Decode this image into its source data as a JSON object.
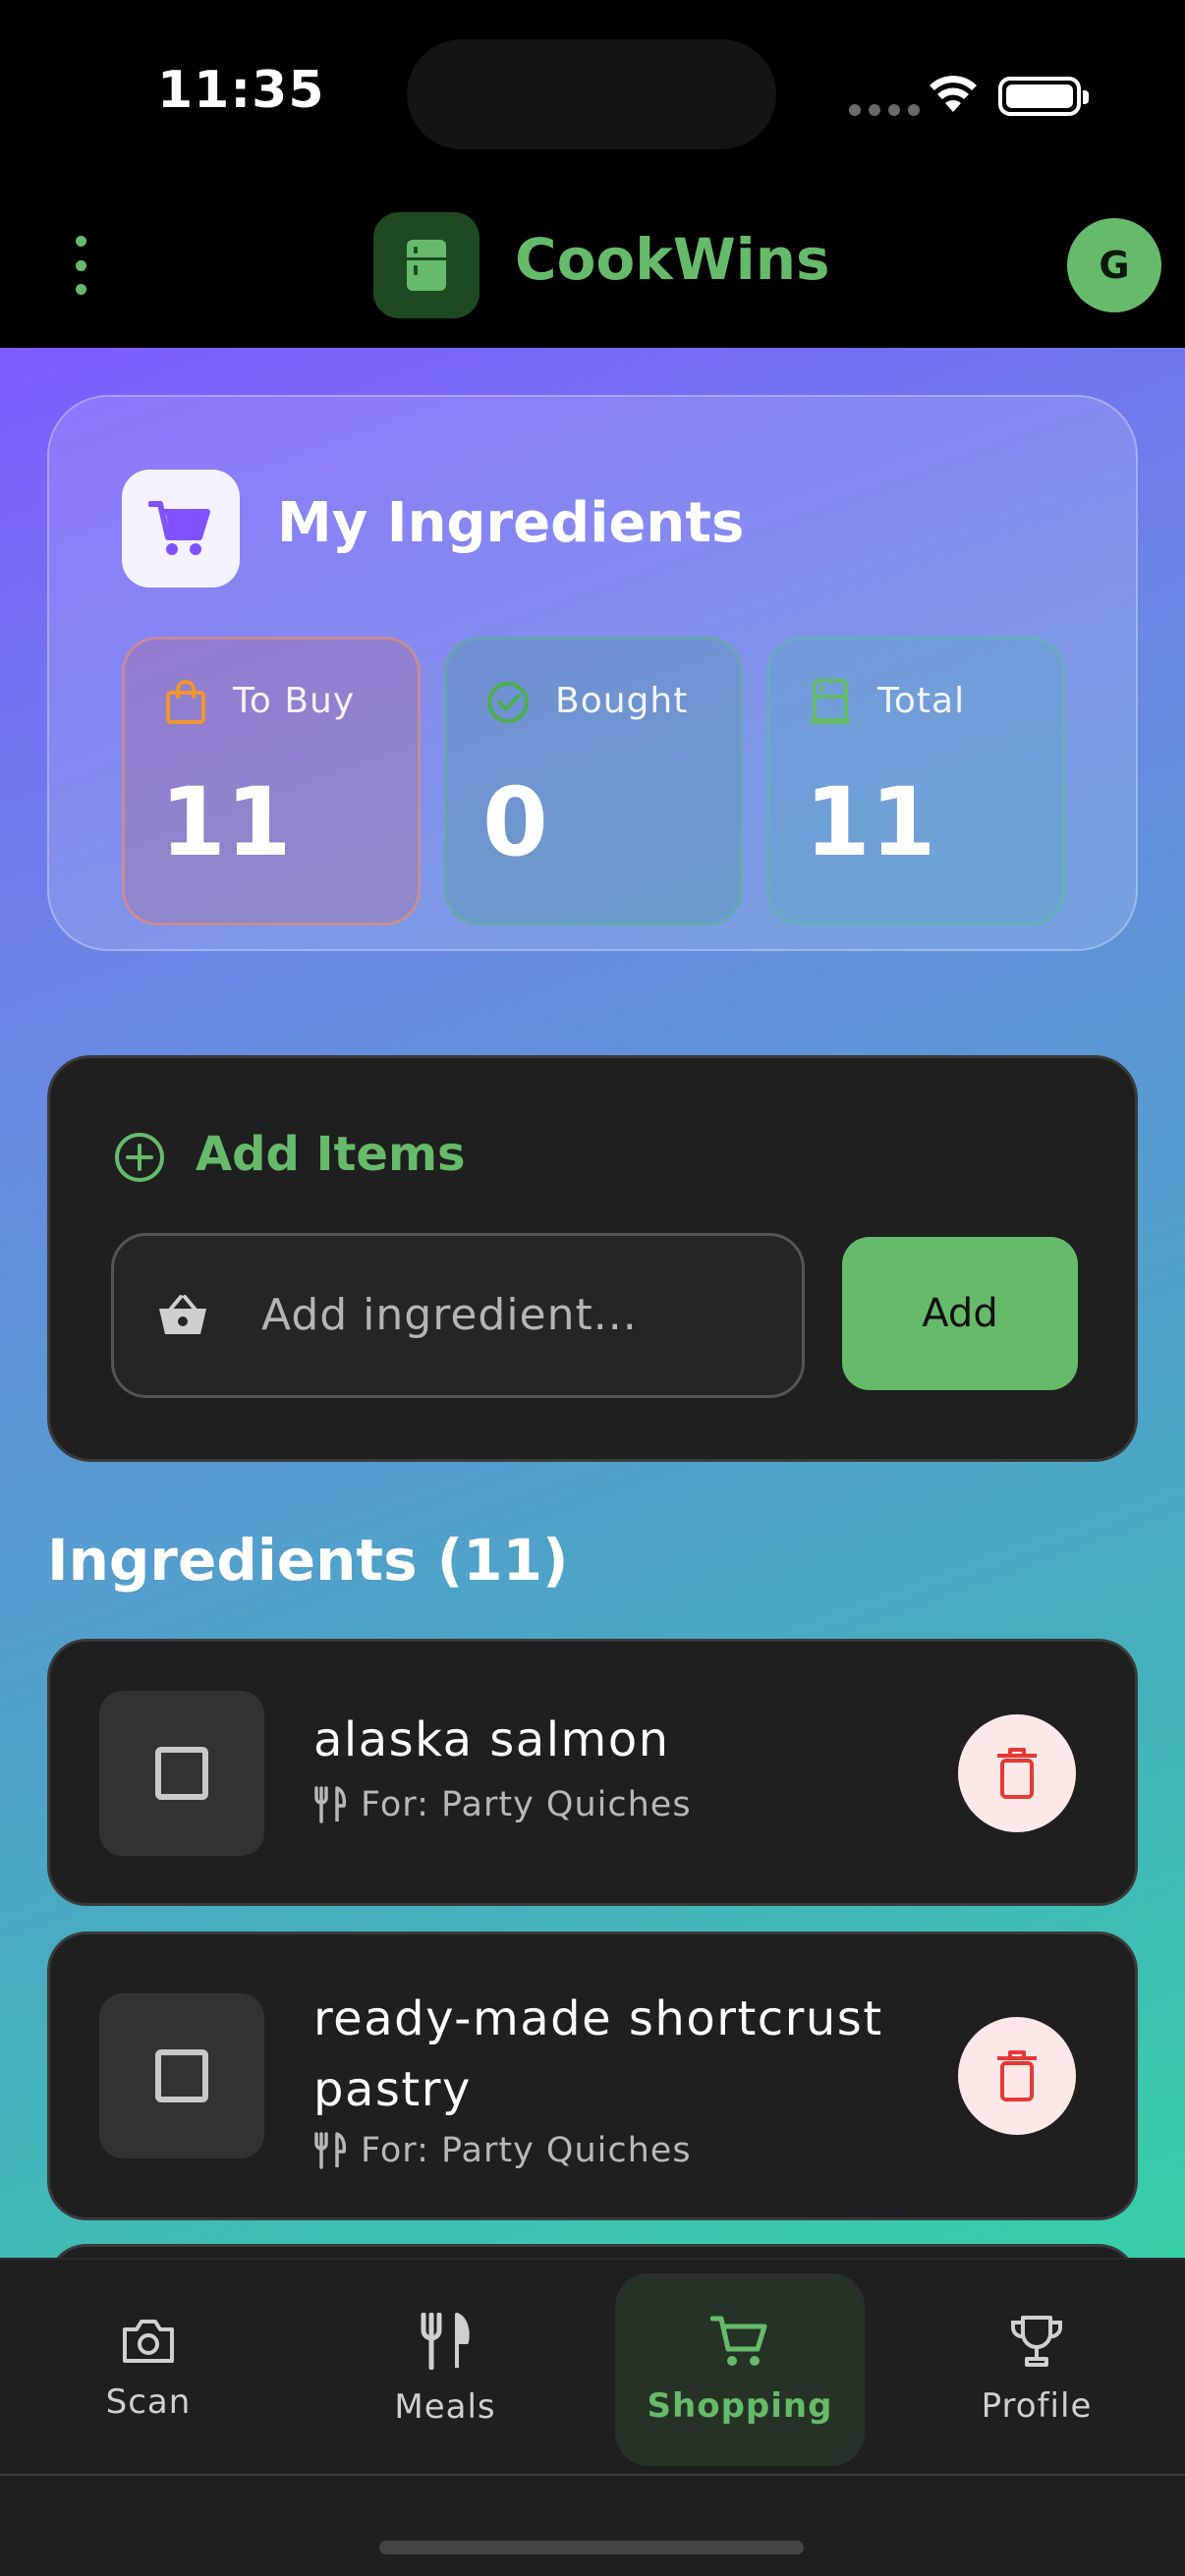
{
  "status_bar": {
    "time": "11:35"
  },
  "header": {
    "app_name": "CookWins",
    "avatar_initial": "G"
  },
  "summary": {
    "title": "My Ingredients",
    "stats": [
      {
        "label": "To Buy",
        "value": "11",
        "icon": "shopping-bag-icon",
        "color": "#f0962f"
      },
      {
        "label": "Bought",
        "value": "0",
        "icon": "check-circle-icon",
        "color": "#4caf50"
      },
      {
        "label": "Total",
        "value": "11",
        "icon": "fridge-icon",
        "color": "#66bb6a"
      }
    ]
  },
  "add_section": {
    "title": "Add Items",
    "placeholder": "Add ingredient...",
    "button_label": "Add"
  },
  "list": {
    "title": "Ingredients (11)",
    "items": [
      {
        "name": "alaska salmon",
        "for": "For: Party Quiches",
        "checked": false
      },
      {
        "name": "ready-made shortcrust pastry",
        "for": "For: Party Quiches",
        "checked": false
      }
    ]
  },
  "bottom_nav": {
    "items": [
      {
        "label": "Scan",
        "icon": "camera-icon",
        "active": false
      },
      {
        "label": "Meals",
        "icon": "fork-knife-icon",
        "active": false
      },
      {
        "label": "Shopping",
        "icon": "cart-icon",
        "active": true
      },
      {
        "label": "Profile",
        "icon": "trophy-icon",
        "active": false
      }
    ]
  },
  "colors": {
    "accent": "#66bb6a",
    "delete": "#e53935",
    "card": "#1f1f1f"
  }
}
